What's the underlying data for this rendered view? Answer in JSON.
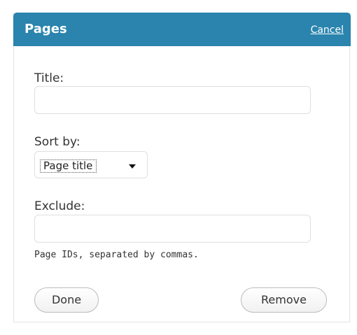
{
  "widget": {
    "title": "Pages",
    "cancel_label": "Cancel"
  },
  "form": {
    "title_label": "Title:",
    "title_value": "",
    "sort_label": "Sort by:",
    "sort_selected": "Page title",
    "exclude_label": "Exclude:",
    "exclude_value": "",
    "exclude_help": "Page IDs, separated by commas."
  },
  "actions": {
    "done_label": "Done",
    "remove_label": "Remove"
  },
  "colors": {
    "header_bg": "#2a84ad",
    "header_text": "#ffffff"
  }
}
